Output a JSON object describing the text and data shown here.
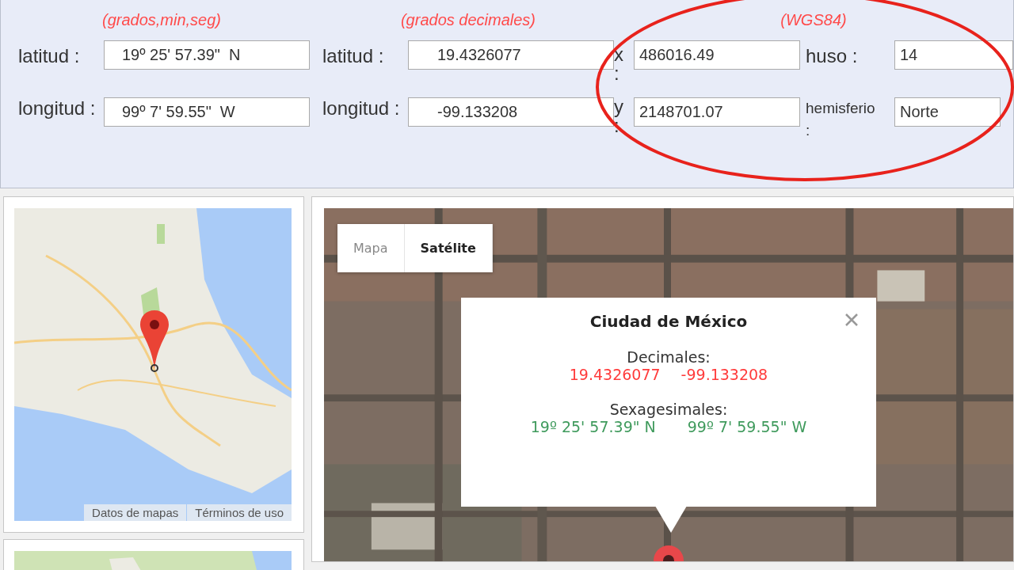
{
  "converter": {
    "columns": [
      {
        "subtitle": "(grados,min,seg)",
        "rows": [
          [
            {
              "label": "latitud :",
              "value": "19º 25' 57.39\"  N"
            }
          ],
          [
            {
              "label": "longitud :",
              "value": "99º 7' 59.55\"  W"
            }
          ]
        ]
      },
      {
        "subtitle": "(grados decimales)",
        "rows": [
          [
            {
              "label": "latitud :",
              "value": "19.4326077"
            }
          ],
          [
            {
              "label": "longitud :",
              "value": "-99.133208"
            }
          ]
        ]
      },
      {
        "subtitle": "(WGS84)",
        "rows": [
          [
            {
              "label": "x :",
              "value": "486016.49"
            },
            {
              "label": "huso :",
              "value": "14"
            }
          ],
          [
            {
              "label": "y :",
              "value": "2148701.07"
            },
            {
              "label": "hemisferio :",
              "value": "Norte"
            }
          ]
        ]
      }
    ]
  },
  "overview_map": {
    "links": [
      "Datos de mapas",
      "Términos de uso"
    ]
  },
  "main_map": {
    "map_types": [
      {
        "label": "Mapa",
        "selected": false
      },
      {
        "label": "Satélite",
        "selected": true
      }
    ],
    "popup": {
      "title": "Ciudad de México",
      "sections": [
        {
          "heading": "Decimales:",
          "color": "#ff3b3b",
          "values": [
            "19.4326077",
            "-99.133208"
          ]
        },
        {
          "heading": "Sexagesimales:",
          "color": "#3f9a5c",
          "values": [
            "19º 25' 57.39\" N",
            "99º 7' 59.55\" W"
          ]
        }
      ]
    }
  }
}
